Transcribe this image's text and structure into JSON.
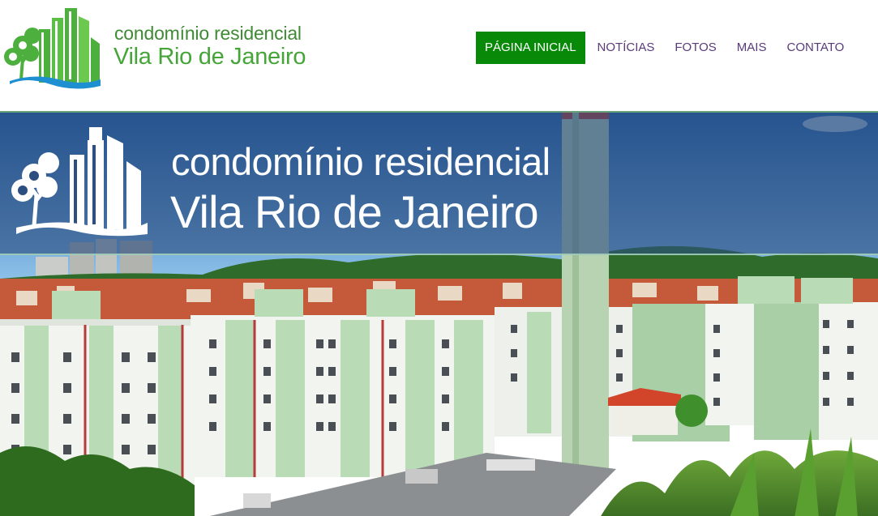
{
  "header": {
    "logo": {
      "line1": "condomínio residencial",
      "line2": "Vila Rio de Janeiro"
    },
    "nav": [
      {
        "label": "PÁGINA INICIAL",
        "active": true
      },
      {
        "label": "NOTÍCIAS",
        "active": false
      },
      {
        "label": "FOTOS",
        "active": false
      },
      {
        "label": "MAIS",
        "active": false
      },
      {
        "label": "CONTATO",
        "active": false
      }
    ]
  },
  "hero": {
    "banner_line1": "condomínio residencial",
    "banner_line2": "Vila Rio de Janeiro"
  },
  "colors": {
    "brand_green": "#45a538",
    "nav_active_bg": "#088a08",
    "nav_text": "#5a3a7a",
    "banner_blue": "#2c4e80"
  }
}
